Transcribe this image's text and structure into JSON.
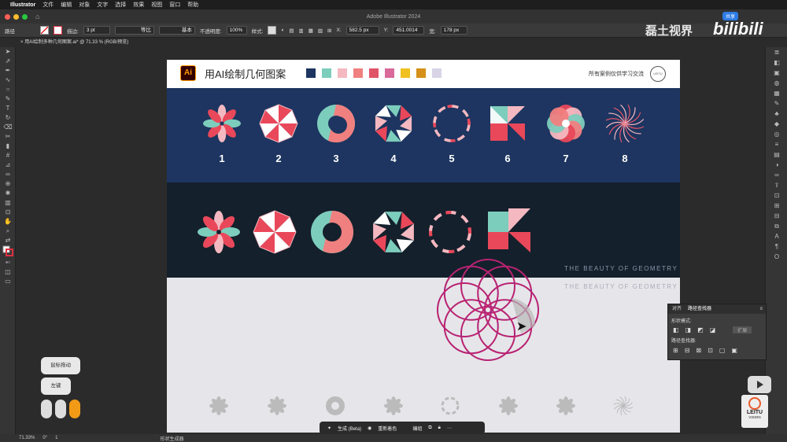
{
  "menubar": {
    "app": "Illustrator",
    "items": [
      "文件",
      "编辑",
      "对象",
      "文字",
      "选择",
      "效果",
      "视图",
      "窗口",
      "帮助"
    ]
  },
  "window": {
    "title": "Adobe Illustrator 2024",
    "share": "共享"
  },
  "control_bar": {
    "object_type": "路径",
    "stroke_label": "描边:",
    "stroke_value": "3 pt",
    "profile": "等比",
    "brush": "基本",
    "opacity_label": "不透明度:",
    "opacity_value": "100%",
    "style_label": "样式:",
    "x_label": "X:",
    "x_value": "582.5 px",
    "y_label": "Y:",
    "y_value": "451.0014",
    "w_label": "宽:",
    "w_value": "178 px"
  },
  "doc_tab": "用AI绘制多种几何图案.ai* @ 71.33 % (RGB/预览)",
  "artboard": {
    "logo": "Ai",
    "title": "用AI绘制几何图案",
    "note": "所有案例仅供学习交流",
    "seal": "LEITU",
    "palette": [
      "#1d3560",
      "#7dcdbd",
      "#f4b8c0",
      "#f08080",
      "#e05468",
      "#d96a9a",
      "#f0c020",
      "#d49018",
      "#d8d4e6"
    ],
    "numbers": [
      "1",
      "2",
      "3",
      "4",
      "5",
      "6",
      "7",
      "8"
    ],
    "tagline": "THE BEAUTY OF GEOMETRY"
  },
  "colors": {
    "teal": "#7dcdbd",
    "pink": "#f4b8c0",
    "red": "#e9485a",
    "white": "#ffffff",
    "navy": "#1d3560"
  },
  "left_buttons": {
    "drag": "鼠标拖动",
    "left": "左键"
  },
  "panel": {
    "tab1": "对齐",
    "tab2": "路径查找器",
    "shape_modes": "形状模式:",
    "pathfinder": "路径查找器:",
    "expand": "扩展"
  },
  "bottom_bar": {
    "generate": "生成 (Beta)",
    "recolor": "重新着色",
    "group": "编组"
  },
  "status": {
    "zoom": "71.33%",
    "angle": "0°",
    "page": "1",
    "tool": "形状生成器"
  },
  "watermark": {
    "text": "磊土视界",
    "brand": "bilibili",
    "leitu": "LEITU",
    "leitu_sub": "VISION"
  }
}
